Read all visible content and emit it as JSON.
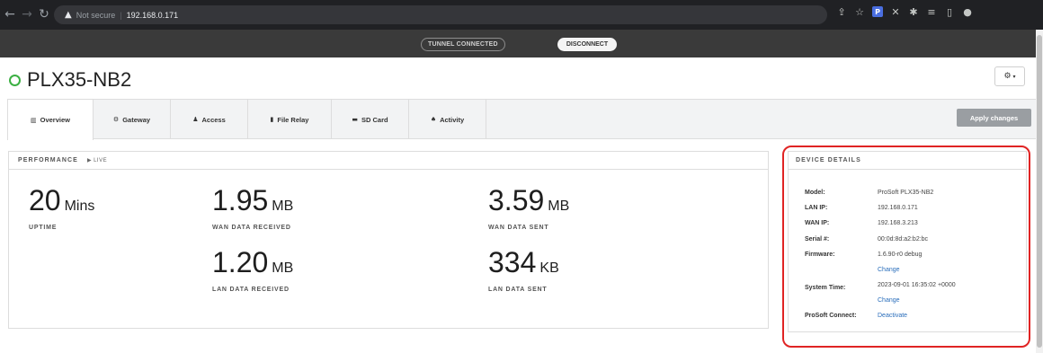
{
  "browser": {
    "security_label": "Not secure",
    "url": "192.168.0.171"
  },
  "tunnel": {
    "status": "TUNNEL CONNECTED",
    "disconnect_label": "DISCONNECT"
  },
  "device": {
    "name": "PLX35-NB2",
    "status_color": "#3cb043"
  },
  "tabs": [
    {
      "label": "Overview",
      "icon": "bar-chart-icon",
      "active": true
    },
    {
      "label": "Gateway",
      "icon": "gear-icon",
      "active": false
    },
    {
      "label": "Access",
      "icon": "user-icon",
      "active": false
    },
    {
      "label": "File Relay",
      "icon": "file-icon",
      "active": false
    },
    {
      "label": "SD Card",
      "icon": "folder-icon",
      "active": false
    },
    {
      "label": "Activity",
      "icon": "bell-icon",
      "active": false
    }
  ],
  "apply_label": "Apply changes",
  "performance": {
    "title": "PERFORMANCE",
    "live": "LIVE",
    "uptime": {
      "value": "20",
      "unit": "Mins",
      "label": "UPTIME"
    },
    "wan_received": {
      "value": "1.95",
      "unit": "MB",
      "label": "WAN DATA RECEIVED"
    },
    "wan_sent": {
      "value": "3.59",
      "unit": "MB",
      "label": "WAN DATA SENT"
    },
    "lan_received": {
      "value": "1.20",
      "unit": "MB",
      "label": "LAN DATA RECEIVED"
    },
    "lan_sent": {
      "value": "334",
      "unit": "KB",
      "label": "LAN DATA SENT"
    }
  },
  "details": {
    "title": "DEVICE DETAILS",
    "model_label": "Model:",
    "model": "ProSoft PLX35-NB2",
    "lan_ip_label": "LAN IP:",
    "lan_ip": "192.168.0.171",
    "wan_ip_label": "WAN IP:",
    "wan_ip": "192.168.3.213",
    "serial_label": "Serial #:",
    "serial": "00:0d:8d:a2:b2:bc",
    "firmware_label": "Firmware:",
    "firmware": "1.6.90-r0 debug",
    "change_label": "Change",
    "system_time_label": "System Time:",
    "system_time": "2023-09-01 16:35:02 +0000",
    "prosoft_connect_label": "ProSoft Connect:",
    "deactivate_label": "Deactivate"
  },
  "colors": {
    "highlight_outline": "#e02424",
    "link": "#2a6ebb"
  }
}
